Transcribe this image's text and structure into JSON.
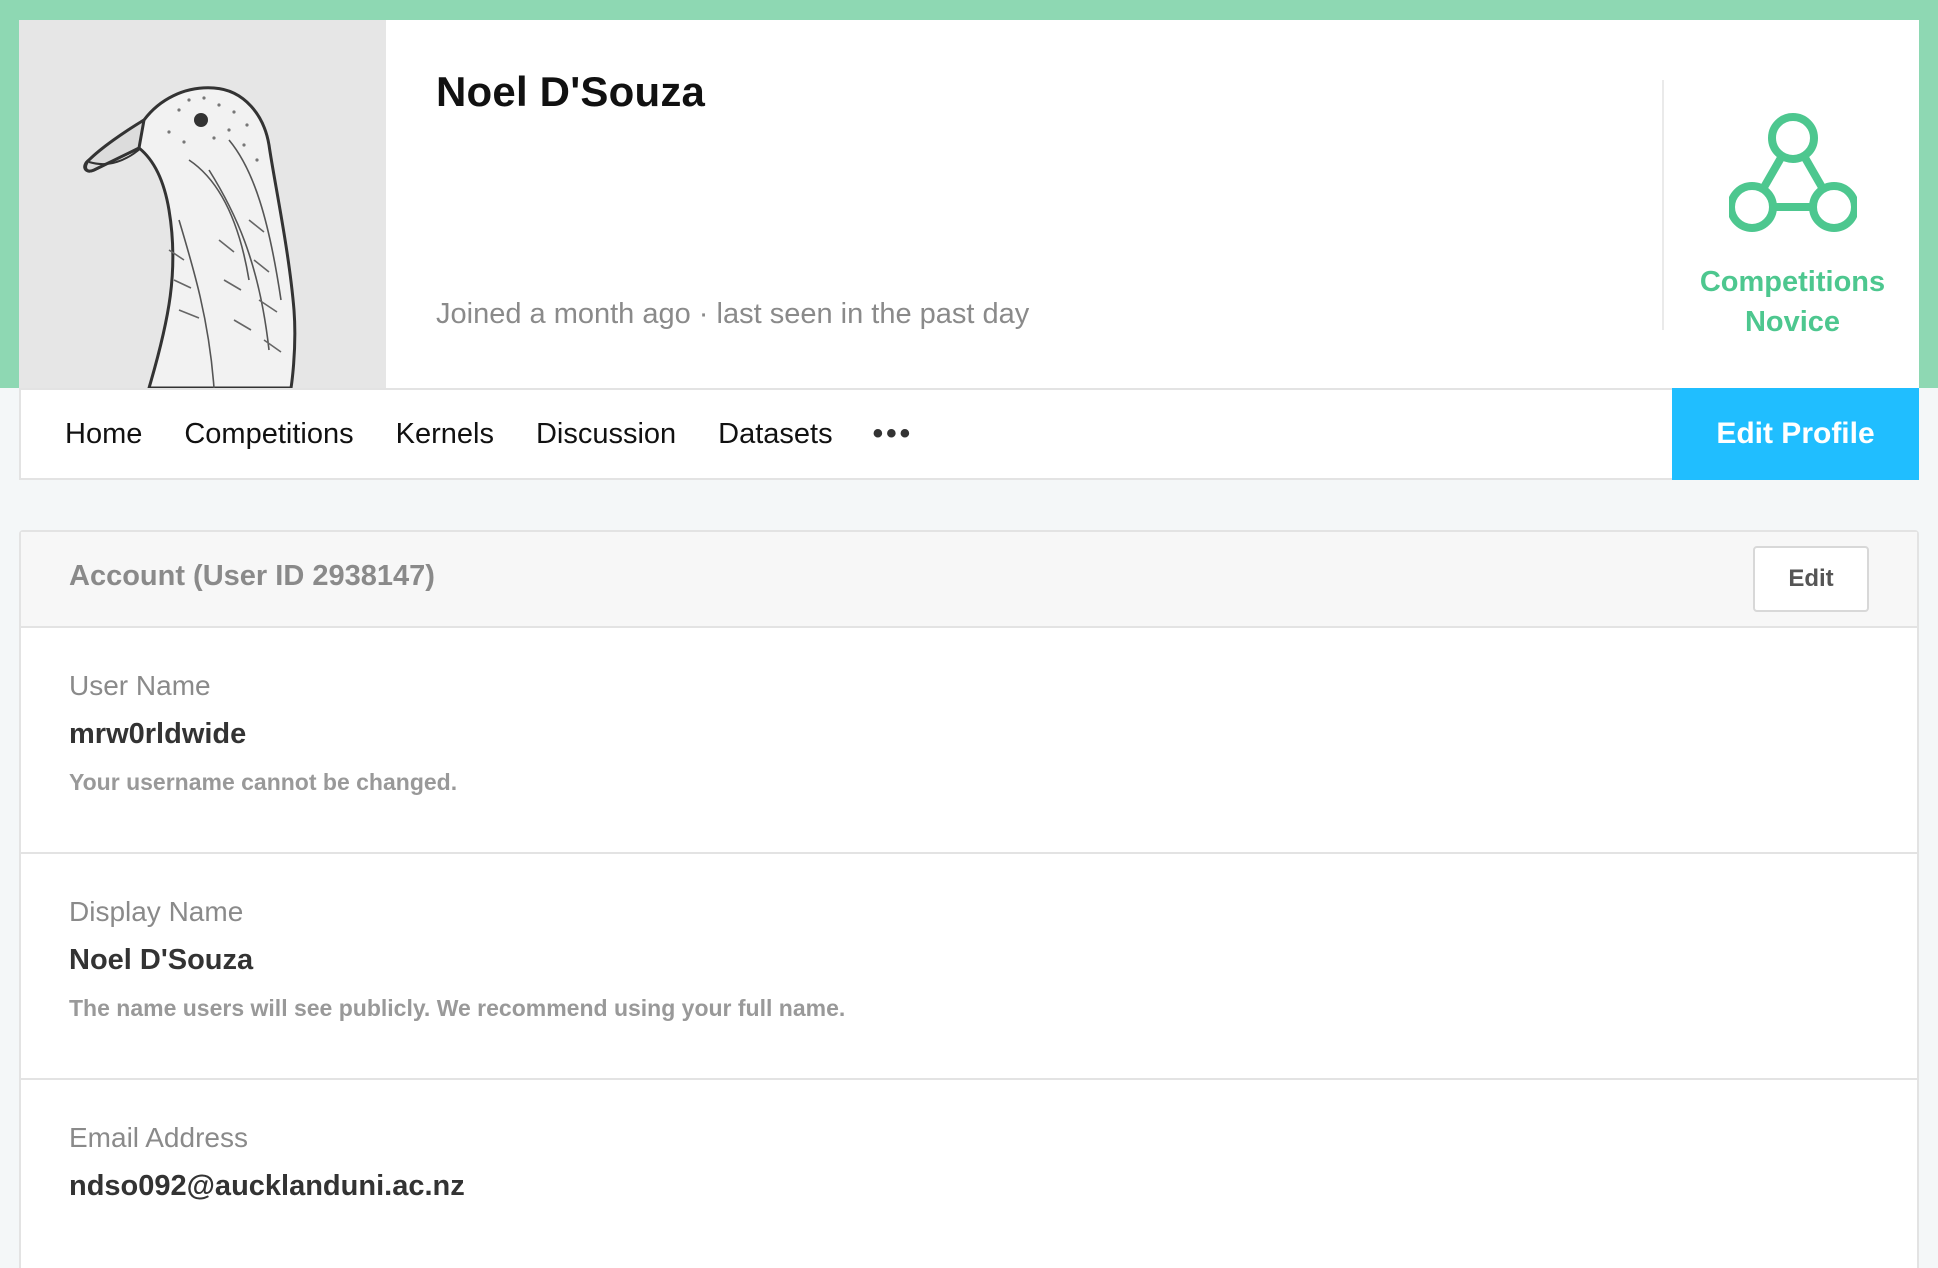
{
  "profile": {
    "name": "Noel D'Souza",
    "meta": "Joined a month ago · last seen in the past day",
    "tier": {
      "line1": "Competitions",
      "line2": "Novice",
      "icon": "novice-tier-icon",
      "color": "#4dc78f"
    },
    "avatar_icon": "goose-avatar"
  },
  "nav": {
    "items": [
      {
        "label": "Home"
      },
      {
        "label": "Competitions"
      },
      {
        "label": "Kernels"
      },
      {
        "label": "Discussion"
      },
      {
        "label": "Datasets"
      }
    ],
    "more": "•••",
    "edit_profile": "Edit Profile"
  },
  "account": {
    "title": "Account (User ID 2938147)",
    "edit_label": "Edit",
    "fields": [
      {
        "label": "User Name",
        "value": "mrw0rldwide",
        "help": "Your username cannot be changed."
      },
      {
        "label": "Display Name",
        "value": "Noel D'Souza",
        "help": "The name users will see publicly. We recommend using your full name."
      },
      {
        "label": "Email Address",
        "value": "ndso092@aucklanduni.ac.nz",
        "help": ""
      }
    ]
  },
  "colors": {
    "brand_band": "#8ed8b3",
    "accent_button": "#20beff"
  }
}
